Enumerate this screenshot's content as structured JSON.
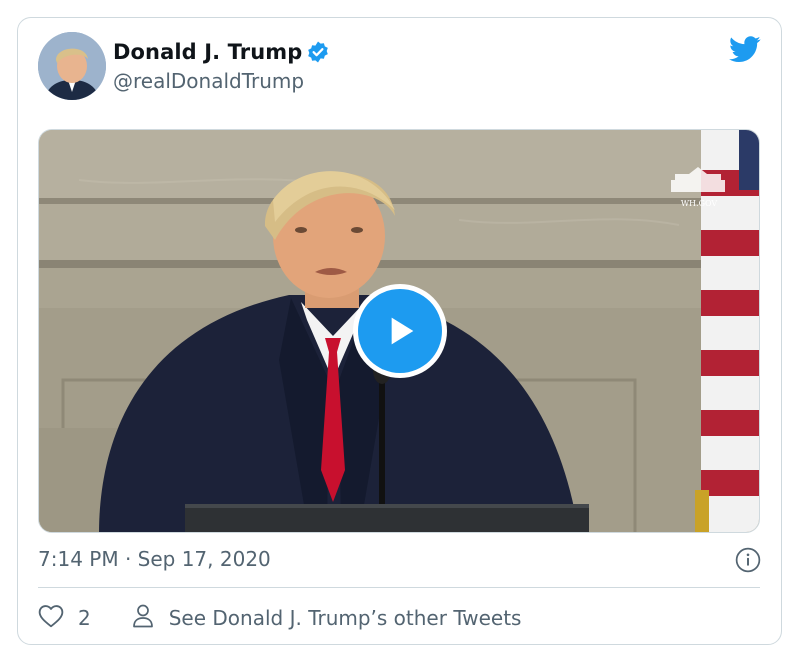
{
  "author": {
    "name": "Donald J. Trump",
    "handle": "@realDonaldTrump",
    "verified": true
  },
  "media": {
    "type": "video",
    "watermark": "WH.GOV"
  },
  "timestamp": "7:14 PM · Sep 17, 2020",
  "actions": {
    "like_count": "2",
    "profile_link_label": "See Donald J. Trump’s other Tweets"
  },
  "colors": {
    "brand_blue": "#1d9bf0",
    "text_secondary": "#536471",
    "border": "#cfd9de"
  },
  "icons": [
    "twitter-bird-icon",
    "verified-badge-icon",
    "play-icon",
    "info-icon",
    "heart-icon",
    "person-icon"
  ]
}
